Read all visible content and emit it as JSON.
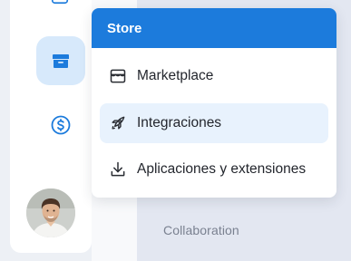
{
  "menu": {
    "header": "Store",
    "items": [
      {
        "label": "Marketplace",
        "icon": "storefront-icon",
        "active": false
      },
      {
        "label": "Integraciones",
        "icon": "rocket-icon",
        "active": true
      },
      {
        "label": "Aplicaciones y extensiones",
        "icon": "download-icon",
        "active": false
      }
    ]
  },
  "sidebar": {
    "icons": [
      "code-icon",
      "store-icon",
      "dollar-icon",
      "user-avatar"
    ],
    "active": "store-icon"
  },
  "background": {
    "section_label": "Collaboration"
  },
  "colors": {
    "accent": "#1c7bdc",
    "active_bg": "#e8f2fd",
    "rail_active_bg": "#d7e9fb"
  }
}
